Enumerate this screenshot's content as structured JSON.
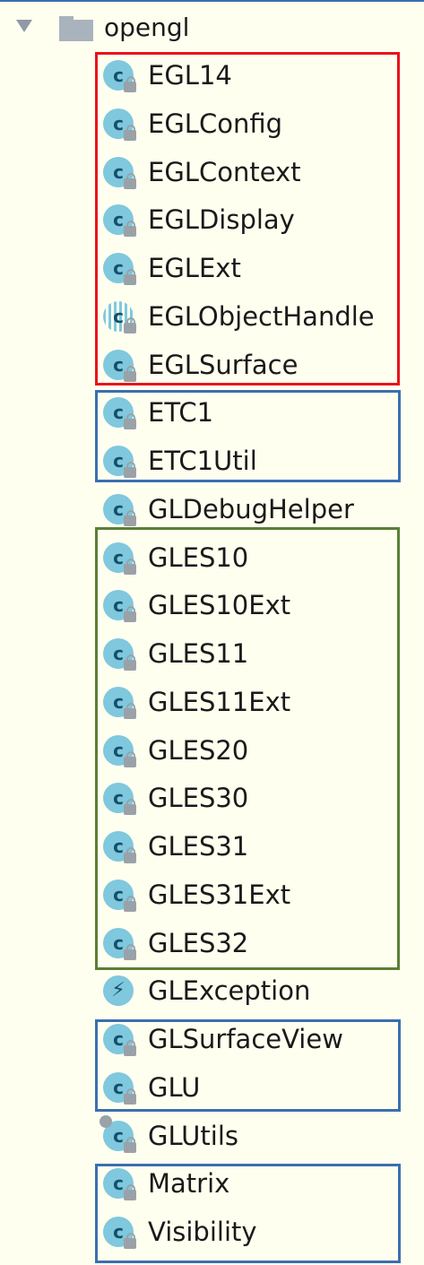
{
  "folder": {
    "name": "opengl",
    "icon": "folder-icon",
    "expand_icon": "triangle-down-icon"
  },
  "colors": {
    "background": "#fffff0",
    "red_box": "#e8141c",
    "blue_box": "#3a6fb0",
    "green_box": "#5b7f34",
    "class_icon": "#7fc8de"
  },
  "items": [
    {
      "label": "EGL14",
      "icon": "class-icon"
    },
    {
      "label": "EGLConfig",
      "icon": "class-icon"
    },
    {
      "label": "EGLContext",
      "icon": "class-icon"
    },
    {
      "label": "EGLDisplay",
      "icon": "class-icon"
    },
    {
      "label": "EGLExt",
      "icon": "class-icon"
    },
    {
      "label": "EGLObjectHandle",
      "icon": "abstract-class-icon"
    },
    {
      "label": "EGLSurface",
      "icon": "class-icon"
    },
    {
      "label": "ETC1",
      "icon": "class-icon"
    },
    {
      "label": "ETC1Util",
      "icon": "class-icon"
    },
    {
      "label": "GLDebugHelper",
      "icon": "class-icon"
    },
    {
      "label": "GLES10",
      "icon": "class-icon"
    },
    {
      "label": "GLES10Ext",
      "icon": "class-icon"
    },
    {
      "label": "GLES11",
      "icon": "class-icon"
    },
    {
      "label": "GLES11Ext",
      "icon": "class-icon"
    },
    {
      "label": "GLES20",
      "icon": "class-icon"
    },
    {
      "label": "GLES30",
      "icon": "class-icon"
    },
    {
      "label": "GLES31",
      "icon": "class-icon"
    },
    {
      "label": "GLES31Ext",
      "icon": "class-icon"
    },
    {
      "label": "GLES32",
      "icon": "class-icon"
    },
    {
      "label": "GLException",
      "icon": "exception-class-icon"
    },
    {
      "label": "GLSurfaceView",
      "icon": "class-icon"
    },
    {
      "label": "GLU",
      "icon": "class-icon"
    },
    {
      "label": "GLUtils",
      "icon": "class-icon"
    },
    {
      "label": "Matrix",
      "icon": "class-icon"
    },
    {
      "label": "Visibility",
      "icon": "class-icon"
    }
  ]
}
